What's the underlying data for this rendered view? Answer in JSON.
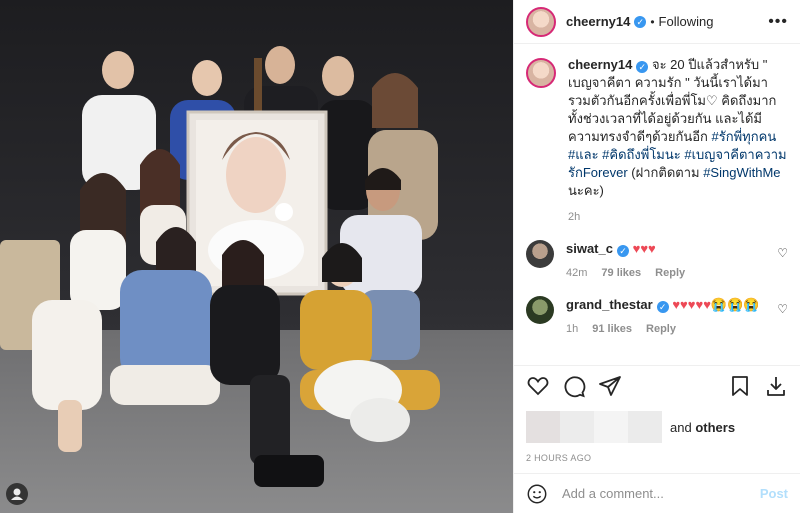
{
  "post": {
    "username": "cheerny14",
    "follow_dot": "•",
    "follow_status": "Following",
    "more_glyph": "•••",
    "caption_text": "จะ 20 ปีแล้วสำหรับ \" เบญจาคีตา ความรัก \" วันนี้เราได้มารวมตัวกันอีกครั้งเพื่อพี่โม♡ คิดถึงมากทั้งช่วงเวลาที่ได้อยู่ด้วยกัน และได้มีความทรงจำดีๆด้วยกันอีก",
    "hashtags_text": "#รักพี่ทุกคน #และ #คิดถึงพี่โมนะ #เบญจาคีตาความรักForever",
    "caption_tail": " (ฝากติดตาม ",
    "caption_tag2": "#SingWithMe",
    "caption_end": " นะคะ)",
    "time": "2h"
  },
  "comments": [
    {
      "username": "siwat_c",
      "text": "♥♥♥",
      "time": "42m",
      "likes": "79 likes",
      "reply": "Reply"
    },
    {
      "username": "grand_thestar",
      "text": "♥♥♥♥♥😭😭😭",
      "time": "1h",
      "likes": "91 likes",
      "reply": "Reply"
    }
  ],
  "likes_line": {
    "and": "and ",
    "others": "others"
  },
  "posted_ago": "2 HOURS AGO",
  "add_comment": {
    "placeholder": "Add a comment...",
    "post_label": "Post"
  },
  "icons": [
    "heart-icon",
    "comment-icon",
    "share-icon",
    "bookmark-icon",
    "download-icon",
    "emoji-icon",
    "more-icon",
    "verified-icon",
    "user-tag-icon"
  ],
  "colors": {
    "link": "#00376b",
    "verified": "#3897f0",
    "heart": "#ed4956",
    "post_disabled": "#b2dffc"
  }
}
